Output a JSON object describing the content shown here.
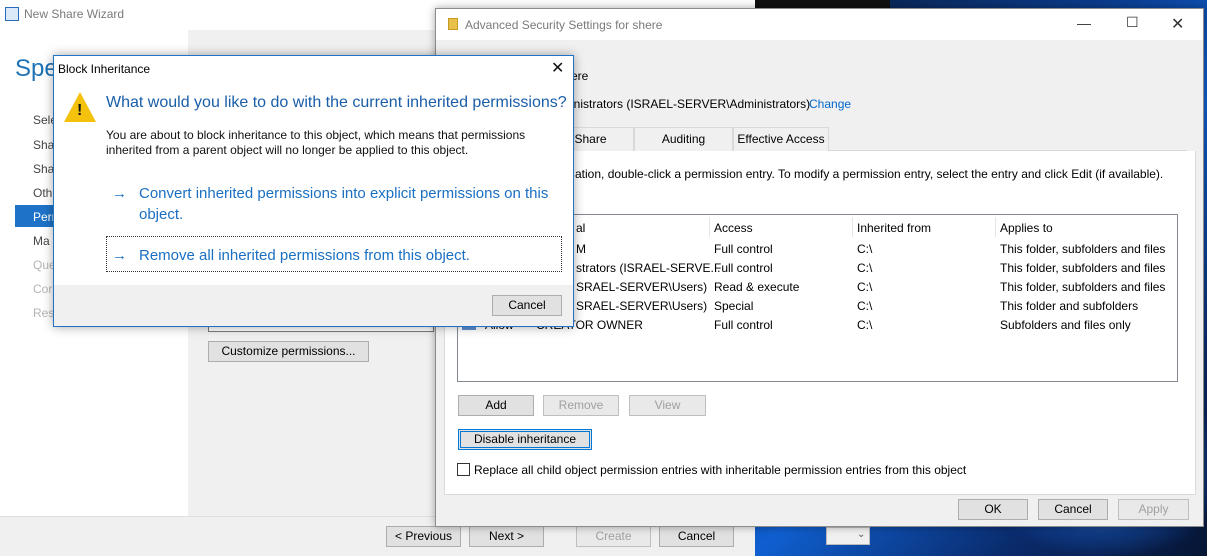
{
  "wizard": {
    "title": "New Share Wizard",
    "heading": "Spe",
    "steps": [
      {
        "label": "Sele",
        "disabled": false
      },
      {
        "label": "Sha",
        "disabled": false
      },
      {
        "label": "Sha",
        "disabled": false
      },
      {
        "label": "Oth",
        "disabled": false
      },
      {
        "label": "Pern",
        "disabled": false,
        "selected": true
      },
      {
        "label": "Ma",
        "disabled": false
      },
      {
        "label": "Que",
        "disabled": true
      },
      {
        "label": "Cor",
        "disabled": true
      },
      {
        "label": "Res",
        "disabled": true
      }
    ],
    "customize_button": "Customize permissions...",
    "footer": {
      "previous": "< Previous",
      "next": "Next >",
      "create": "Create",
      "cancel": "Cancel"
    }
  },
  "advanced": {
    "title": "Advanced Security Settings for shere",
    "name_fragment": "ere",
    "owner_fragment": "inistrators (ISRAEL-SERVER\\Administrators)",
    "owner_change": "Change",
    "tabs": [
      "Share",
      "Auditing",
      "Effective Access"
    ],
    "instruction": "ation, double-click a permission entry. To modify a permission entry, select the entry and click Edit (if available).",
    "columns": {
      "principal": "al",
      "access": "Access",
      "inherited": "Inherited from",
      "applies": "Applies to"
    },
    "rows": [
      {
        "type": "",
        "principal": "M",
        "access": "Full control",
        "inherited": "C:\\",
        "applies": "This folder, subfolders and files"
      },
      {
        "type": "",
        "principal": "strators (ISRAEL-SERVE...",
        "access": "Full control",
        "inherited": "C:\\",
        "applies": "This folder, subfolders and files"
      },
      {
        "type": "",
        "principal": "SRAEL-SERVER\\Users)",
        "access": "Read & execute",
        "inherited": "C:\\",
        "applies": "This folder, subfolders and files"
      },
      {
        "type": "",
        "principal": "SRAEL-SERVER\\Users)",
        "access": "Special",
        "inherited": "C:\\",
        "applies": "This folder and subfolders"
      },
      {
        "type": "Allow",
        "principal": "CREATOR OWNER",
        "access": "Full control",
        "inherited": "C:\\",
        "applies": "Subfolders and files only"
      }
    ],
    "buttons": {
      "add": "Add",
      "remove": "Remove",
      "view": "View",
      "disable_inheritance": "Disable inheritance"
    },
    "replace_checkbox": "Replace all child object permission entries with inheritable permission entries from this object",
    "replace_checked": false,
    "footer": {
      "ok": "OK",
      "cancel": "Cancel",
      "apply": "Apply"
    }
  },
  "dialog": {
    "title": "Block Inheritance",
    "question": "What would you like to do with the current inherited permissions?",
    "message": "You are about to block inheritance to this object, which means that permissions inherited from a parent object will no longer be applied to this object.",
    "option_convert": "Convert inherited permissions into explicit permissions on this object.",
    "option_remove": "Remove all inherited permissions from this object.",
    "arrow": "→",
    "cancel": "Cancel"
  },
  "colors": {
    "accent": "#1e73c8",
    "link": "#0066cc",
    "warning": "#f4c20d"
  }
}
